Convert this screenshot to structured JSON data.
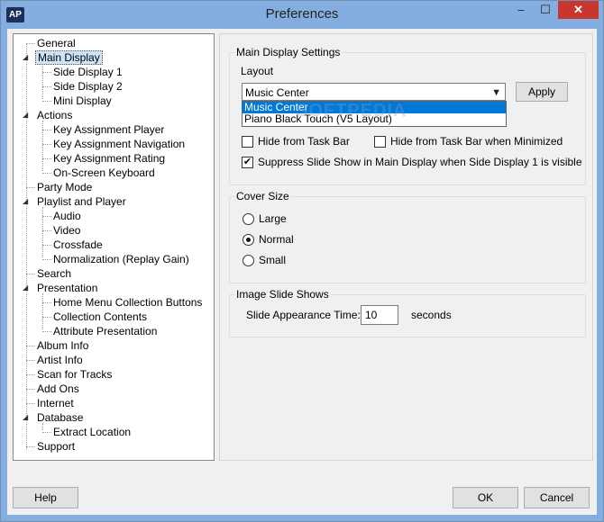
{
  "window": {
    "title": "Preferences",
    "app_icon_text": "AP",
    "minimize": "–",
    "maximize": "☐",
    "close": "✕"
  },
  "tree": {
    "items": [
      "General",
      "Main Display",
      "Side Display 1",
      "Side Display 2",
      "Mini Display",
      "Actions",
      "Key Assignment Player",
      "Key Assignment Navigation",
      "Key Assignment Rating",
      "On-Screen Keyboard",
      "Party Mode",
      "Playlist and Player",
      "Audio",
      "Video",
      "Crossfade",
      "Normalization (Replay Gain)",
      "Search",
      "Presentation",
      "Home Menu Collection Buttons",
      "Collection Contents",
      "Attribute Presentation",
      "Album Info",
      "Artist Info",
      "Scan for Tracks",
      "Add Ons",
      "Internet",
      "Database",
      "Extract Location",
      "Support"
    ]
  },
  "main_display": {
    "group_title": "Main Display Settings",
    "layout_label": "Layout",
    "layout_value": "Music Center",
    "apply_label": "Apply",
    "layout_options": [
      "Music Center",
      "Piano Black Touch (V5 Layout)"
    ],
    "hide_taskbar_label": "Hide from Task Bar",
    "hide_taskbar_minimized_label": "Hide from Task Bar when Minimized",
    "suppress_slideshow_label": "Suppress Slide Show in Main Display when Side Display 1 is visible",
    "suppress_slideshow_checked": true
  },
  "cover_size": {
    "group_title": "Cover Size",
    "options": [
      "Large",
      "Normal",
      "Small"
    ],
    "selected": "Normal"
  },
  "slide_shows": {
    "group_title": "Image Slide Shows",
    "appearance_label": "Slide Appearance Time:",
    "appearance_value": "10",
    "unit": "seconds"
  },
  "footer": {
    "help": "Help",
    "ok": "OK",
    "cancel": "Cancel"
  },
  "watermark": "SOFTPEDIA"
}
